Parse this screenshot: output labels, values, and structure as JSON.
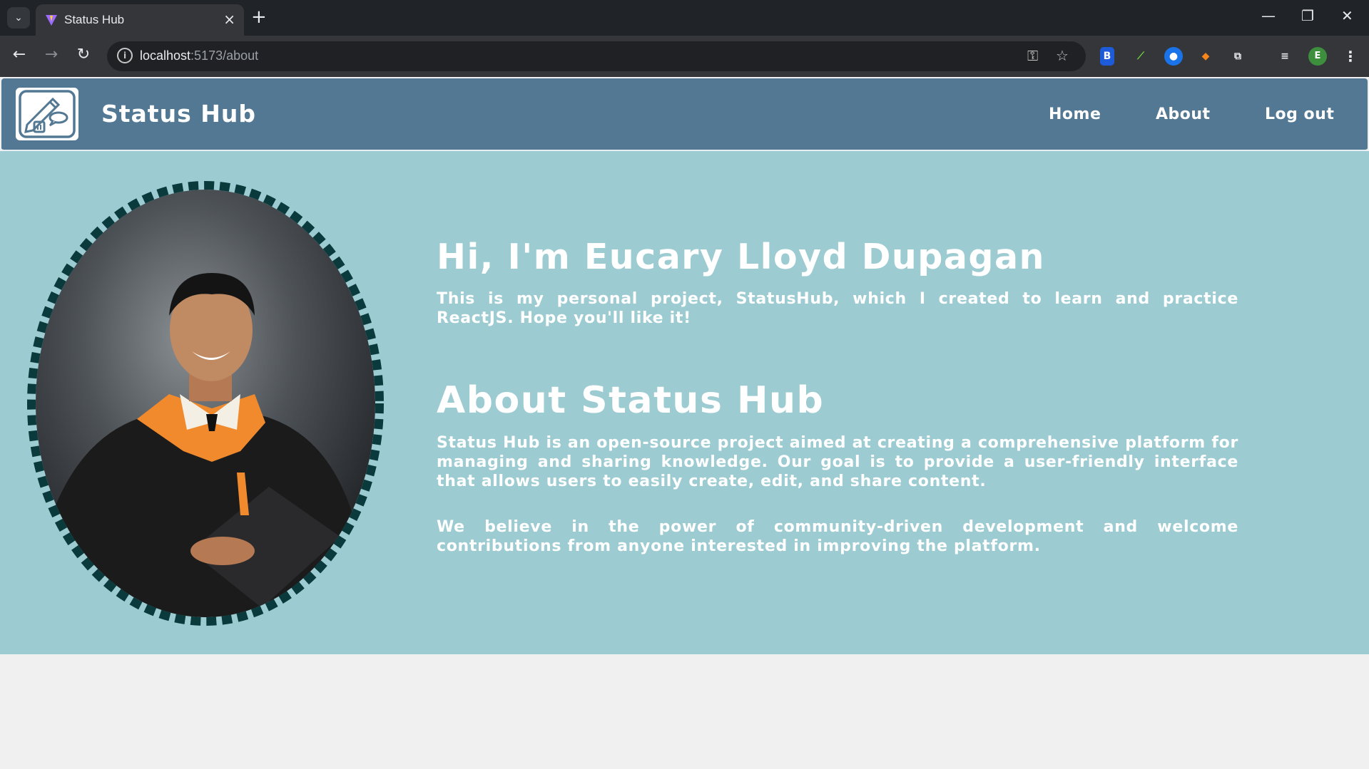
{
  "browser": {
    "tab_title": "Status Hub",
    "tab_close": "×",
    "new_tab": "+",
    "url_host": "localhost",
    "url_path": ":5173/about",
    "profile_initial": "E",
    "ext_1": "B",
    "minimize": "—",
    "restore": "❐",
    "close": "✕"
  },
  "navbar": {
    "brand": "Status Hub",
    "links": [
      "Home",
      "About",
      "Log out"
    ]
  },
  "about": {
    "greeting": "Hi, I'm Eucary Lloyd Dupagan",
    "intro": "This is my personal project, StatusHub, which I created to learn and practice ReactJS. Hope you'll like it!",
    "heading": "About Status Hub",
    "description": "Status Hub is an open-source project aimed at creating a comprehensive platform for managing and sharing knowledge. Our goal is to provide a user-friendly interface that allows users to easily create, edit, and share content.",
    "community": "We believe in the power of community-driven development and welcome contributions from anyone interested in improving the platform."
  },
  "colors": {
    "navbar": "#537893",
    "hero": "#9ccbd1",
    "portrait_border": "#0b3a3d"
  }
}
